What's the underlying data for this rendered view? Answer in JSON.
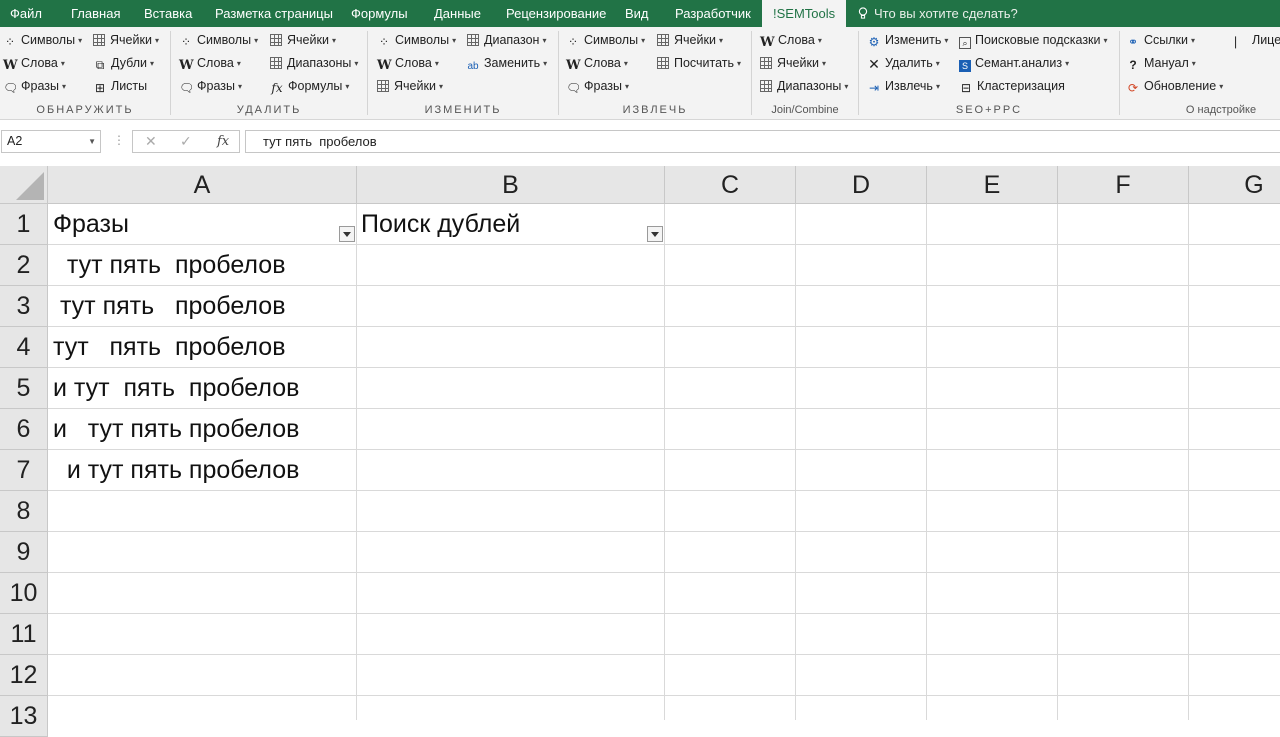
{
  "tabs": [
    "Файл",
    "Главная",
    "Вставка",
    "Разметка страницы",
    "Формулы",
    "Данные",
    "Рецензирование",
    "Вид",
    "Разработчик",
    "!SEMTools",
    "Что вы хотите сделать?"
  ],
  "ribbon": {
    "detect": {
      "symbols": "Символы",
      "cells": "Ячейки",
      "words": "Слова",
      "dupes": "Дубли",
      "phrases": "Фразы",
      "sheets": "Листы",
      "label": "ОБНАРУЖИТЬ"
    },
    "remove": {
      "symbols": "Символы",
      "cells": "Ячейки",
      "words": "Слова",
      "ranges": "Диапазоны",
      "phrases": "Фразы",
      "formulas": "Формулы",
      "label": "УДАЛИТЬ"
    },
    "change": {
      "symbols": "Символы",
      "range": "Диапазон",
      "words": "Слова",
      "replace": "Заменить",
      "cells": "Ячейки",
      "label": "ИЗМЕНИТЬ"
    },
    "extract": {
      "symbols": "Символы",
      "cells": "Ячейки",
      "words": "Слова",
      "count": "Посчитать",
      "phrases": "Фразы",
      "label": "ИЗВЛЕЧЬ"
    },
    "join": {
      "words": "Слова",
      "cells": "Ячейки",
      "ranges": "Диапазоны",
      "label": "Join/Combine"
    },
    "seo": {
      "modify": "Изменить",
      "suggest": "Поисковые подсказки",
      "delete": "Удалить",
      "semantic": "Семант.анализ",
      "extract": "Извлечь",
      "cluster": "Кластеризация",
      "label": "SEO+PPC"
    },
    "about": {
      "links": "Ссылки",
      "manual": "Мануал",
      "update": "Обновление",
      "license": "Лице",
      "label": "О надстройке"
    }
  },
  "formula_bar": {
    "name_box": "A2",
    "formula": "тут пять  пробелов"
  },
  "columns": [
    "A",
    "B",
    "C",
    "D",
    "E",
    "F",
    "G"
  ],
  "rows": [
    "1",
    "2",
    "3",
    "4",
    "5",
    "6",
    "7",
    "8",
    "9",
    "10",
    "11",
    "12",
    "13"
  ],
  "cells": {
    "A1": "Фразы",
    "B1": "Поиск дублей",
    "A2": "  тут пять  пробелов",
    "A3": " тут пять   пробелов",
    "A4": "тут   пять  пробелов",
    "A5": "и тут  пять  пробелов",
    "A6": "и   тут пять пробелов",
    "A7": "  и тут пять пробелов"
  },
  "colors": {
    "accent": "#217346",
    "ribbon_bg": "#f3f3f3",
    "header_bg": "#e6e6e6",
    "gridline": "#d9d9d9"
  }
}
